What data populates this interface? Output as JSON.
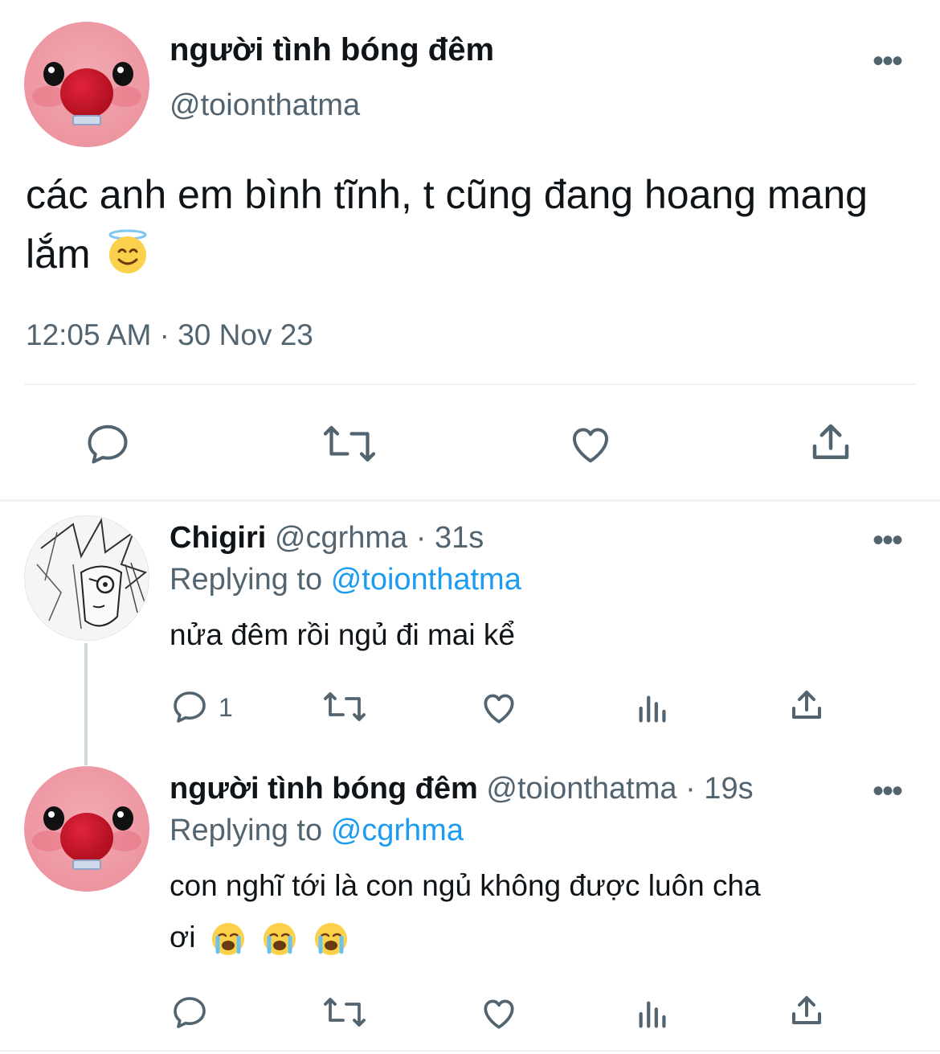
{
  "tweet": {
    "name": "người tình bóng đêm",
    "handle": "@toionthatma",
    "text": "các anh em bình tĩnh, t cũng đang hoang mang lắm",
    "emoji": "smiling-face-with-halo",
    "timestamp": "12:05 AM · 30 Nov 23",
    "more_label": "•••"
  },
  "replies": [
    {
      "name": "Chigiri",
      "handle": "@cgrhma",
      "time": "· 31s",
      "replying_prefix": "Replying to",
      "replying_to": "@toionthatma",
      "text": "nửa đêm rồi ngủ đi mai kể",
      "reply_count": "1",
      "more_label": "•••"
    },
    {
      "name": "người tình bóng đêm",
      "handle": "@toionthatma",
      "time": "· 19s",
      "replying_prefix": "Replying to",
      "replying_to": "@cgrhma",
      "text_line1": "con nghĩ tới là con ngủ không được luôn cha",
      "text_line2": "ơi",
      "emojis": [
        "loudly-crying-face",
        "loudly-crying-face",
        "loudly-crying-face"
      ],
      "more_label": "•••"
    }
  ],
  "colors": {
    "text": "#0f1419",
    "muted": "#536471",
    "link": "#1d9bf0",
    "divider": "#eff3f4"
  }
}
